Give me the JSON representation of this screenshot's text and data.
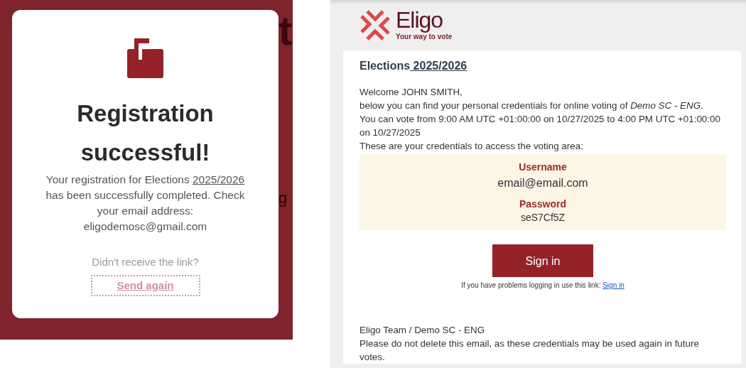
{
  "background_fragments": [
    "t",
    "g"
  ],
  "registration_modal": {
    "title": "Registration successful!",
    "message_before": "Your registration for Elections",
    "message_link": "2025/2026",
    "message_after": "has been successfully completed. Check your email address: eligodemosc@gmail.com",
    "resend_prompt": "Didn't receive the link?",
    "resend_button": "Send again"
  },
  "email": {
    "logo": {
      "name": "Eligo",
      "tagline": "Your way to vote"
    },
    "heading": "Elections",
    "heading_link": "2025/2026",
    "greeting": "Welcome JOHN SMITH,",
    "intro": "below you can find your personal credentials for online voting of *Demo SC - ENG*.",
    "schedule": "You can vote from 9:00 AM UTC +01:00:00 on 10/27/2025 to 4:00 PM UTC +01:00:00 on 10/27/2025",
    "credentials_intro": "These are your credentials to access the voting area:",
    "credentials": [
      {
        "kind": "username",
        "label": "Username",
        "value": "email@email.com"
      },
      {
        "kind": "password",
        "label": "Password",
        "value": "seS7Cf5Z"
      }
    ],
    "sign_in_button": "Sign in",
    "help_text": "If you have problems logging in use this link:",
    "help_link": "Sign in",
    "signature": "Eligo Team / Demo SC - ENG",
    "footer_note": "Please do not delete this email, as these credentials may be used again in future votes."
  }
}
